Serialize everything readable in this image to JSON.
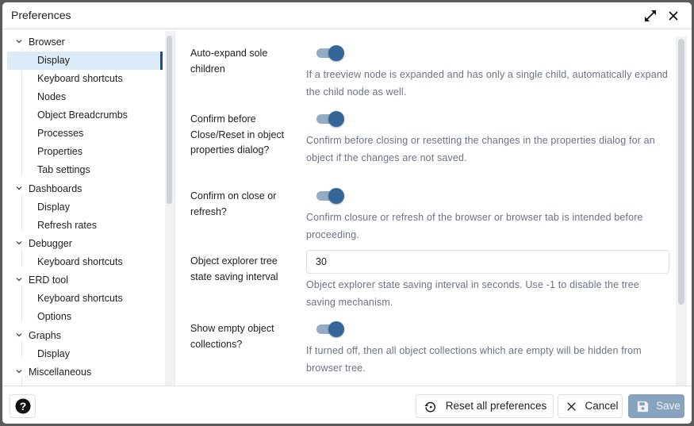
{
  "dialog": {
    "title": "Preferences",
    "expand_icon": "expand-arrows-icon",
    "close_icon": "close-icon"
  },
  "sidebar": {
    "groups": [
      {
        "label": "Browser",
        "expanded": true,
        "children": [
          "Display",
          "Keyboard shortcuts",
          "Nodes",
          "Object Breadcrumbs",
          "Processes",
          "Properties",
          "Tab settings"
        ]
      },
      {
        "label": "Dashboards",
        "expanded": true,
        "children": [
          "Display",
          "Refresh rates"
        ]
      },
      {
        "label": "Debugger",
        "expanded": true,
        "children": [
          "Keyboard shortcuts"
        ]
      },
      {
        "label": "ERD tool",
        "expanded": true,
        "children": [
          "Keyboard shortcuts",
          "Options"
        ]
      },
      {
        "label": "Graphs",
        "expanded": true,
        "children": [
          "Display"
        ]
      },
      {
        "label": "Miscellaneous",
        "expanded": true,
        "children": []
      }
    ],
    "selected": "Browser > Display"
  },
  "settings": [
    {
      "label": "Auto-expand sole children",
      "type": "switch",
      "value": true,
      "help": "If a treeview node is expanded and has only a single child, automatically expand the child node as well."
    },
    {
      "label": "Confirm before Close/Reset in object properties dialog?",
      "type": "switch",
      "value": true,
      "help": "Confirm before closing or resetting the changes in the properties dialog for an object if the changes are not saved."
    },
    {
      "label": "Confirm on close or refresh?",
      "type": "switch",
      "value": true,
      "help": "Confirm closure or refresh of the browser or browser tab is intended before proceeding."
    },
    {
      "label": "Object explorer tree state saving interval",
      "type": "text",
      "value": "30",
      "help": "Object explorer state saving interval in seconds. Use -1 to disable the tree saving mechanism."
    },
    {
      "label": "Show empty object collections?",
      "type": "switch",
      "value": true,
      "help": "If turned off, then all object collections which are empty will be hidden from browser tree."
    }
  ],
  "footer": {
    "help_icon": "help-circle-icon",
    "reset_label": "Reset all preferences",
    "cancel_label": "Cancel",
    "save_label": "Save"
  },
  "colors": {
    "accent": "#336699",
    "switch_track": "#96aac4",
    "selected_bg": "#dbecf8",
    "save_disabled": "#87a3c0",
    "help_text": "#6b7387"
  }
}
